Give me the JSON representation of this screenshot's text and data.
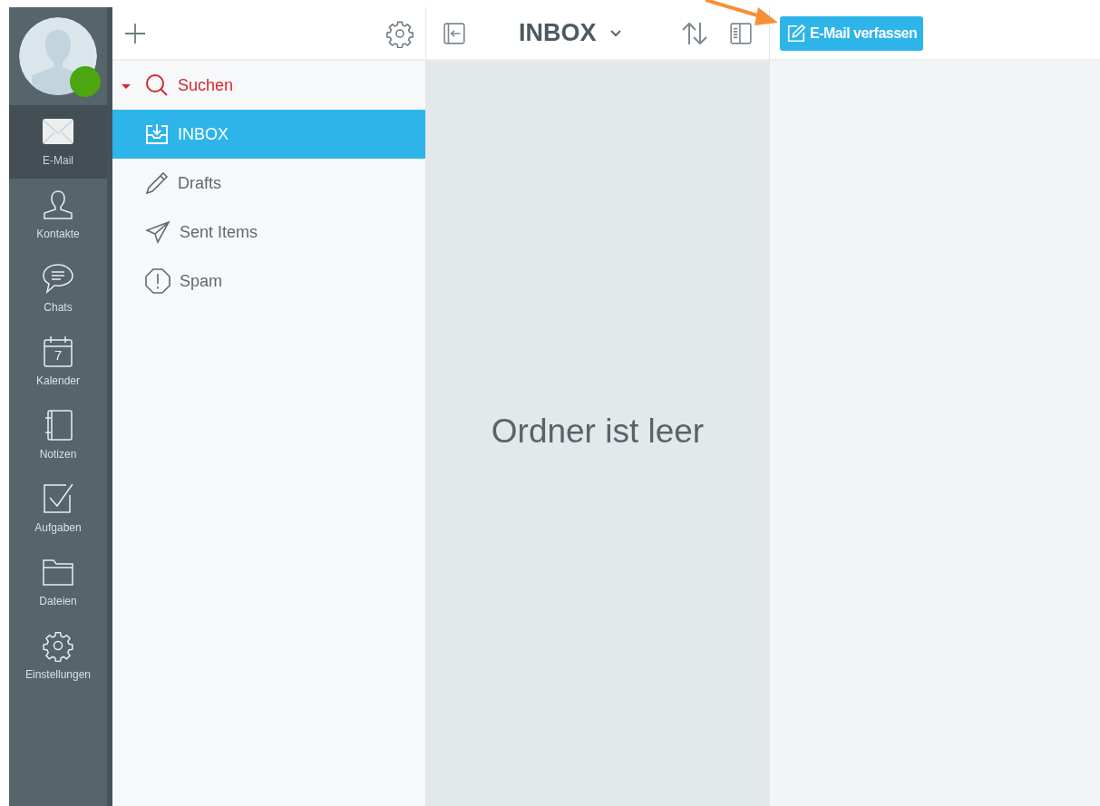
{
  "nav": {
    "items": [
      {
        "kind": "mail",
        "label": "E-Mail",
        "selected": true
      },
      {
        "kind": "contact",
        "label": "Kontakte",
        "selected": false
      },
      {
        "kind": "chat",
        "label": "Chats",
        "selected": false
      },
      {
        "kind": "calendar",
        "label": "Kalender",
        "selected": false,
        "icon_text": "7"
      },
      {
        "kind": "notes",
        "label": "Notizen",
        "selected": false
      },
      {
        "kind": "tasks",
        "label": "Aufgaben",
        "selected": false
      },
      {
        "kind": "folder",
        "label": "Dateien",
        "selected": false
      },
      {
        "kind": "gear",
        "label": "Einstellungen",
        "selected": false
      }
    ],
    "avatar": {
      "online": true
    }
  },
  "folders": {
    "items": [
      {
        "kind": "search",
        "label": "Suchen",
        "expanded": true,
        "selected": false
      },
      {
        "kind": "inbox",
        "label": "INBOX",
        "selected": true
      },
      {
        "kind": "drafts",
        "label": "Drafts",
        "selected": false
      },
      {
        "kind": "sent",
        "label": "Sent Items",
        "selected": false
      },
      {
        "kind": "spam",
        "label": "Spam",
        "selected": false
      }
    ]
  },
  "list": {
    "title": "INBOX",
    "empty_text": "Ordner ist leer"
  },
  "compose_button": "E-Mail verfassen"
}
